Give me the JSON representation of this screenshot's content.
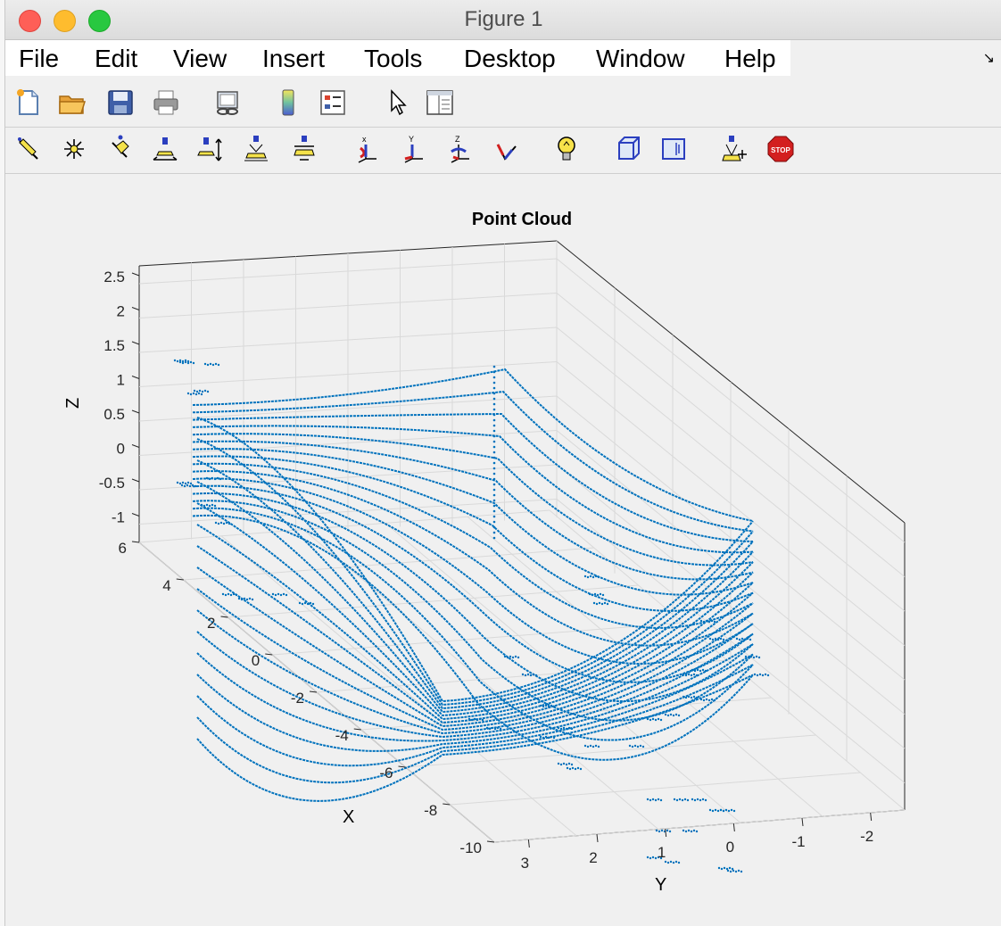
{
  "window": {
    "title": "Figure 1"
  },
  "menu": [
    "File",
    "Edit",
    "View",
    "Insert",
    "Tools",
    "Desktop",
    "Window",
    "Help"
  ],
  "toolbar1": [
    {
      "name": "new-figure-icon"
    },
    {
      "name": "open-file-icon"
    },
    {
      "name": "save-icon"
    },
    {
      "name": "print-icon"
    },
    {
      "name": "link-plot-icon"
    },
    {
      "name": "colorbar-icon"
    },
    {
      "name": "legend-icon"
    },
    {
      "name": "edit-plot-arrow-icon"
    },
    {
      "name": "property-editor-icon"
    }
  ],
  "toolbar2": [
    {
      "name": "edit-line-icon"
    },
    {
      "name": "edit-points-icon"
    },
    {
      "name": "edit-arrow-icon"
    },
    {
      "name": "move-horizontal-icon"
    },
    {
      "name": "move-vertical-icon"
    },
    {
      "name": "move-depth-icon"
    },
    {
      "name": "move-plane-icon"
    },
    {
      "name": "rotate-x-icon"
    },
    {
      "name": "rotate-y-icon"
    },
    {
      "name": "rotate-z-icon"
    },
    {
      "name": "rotate-free-icon"
    },
    {
      "name": "light-bulb-icon"
    },
    {
      "name": "box-3d-icon"
    },
    {
      "name": "box-2d-icon"
    },
    {
      "name": "camera-light-icon"
    },
    {
      "name": "stop-icon"
    }
  ],
  "chart_data": {
    "type": "scatter",
    "title": "Point Cloud",
    "xlabel": "X",
    "ylabel": "Y",
    "zlabel": "Z",
    "xlim": [
      -10,
      6
    ],
    "ylim": [
      -2.5,
      3.5
    ],
    "zlim": [
      -1.5,
      2.5
    ],
    "xticks": [
      "6",
      "4",
      "2",
      "0",
      "-2",
      "-4",
      "-6",
      "-8",
      "-10"
    ],
    "yticks": [
      "3",
      "2",
      "1",
      "0",
      "-1",
      "-2"
    ],
    "zticks": [
      "2.5",
      "2",
      "1.5",
      "1",
      "0.5",
      "0",
      "-0.5",
      "-1"
    ],
    "grid": true,
    "color": "#0072bd",
    "description_series": {
      "name": "",
      "scan_rings": 16
    }
  }
}
